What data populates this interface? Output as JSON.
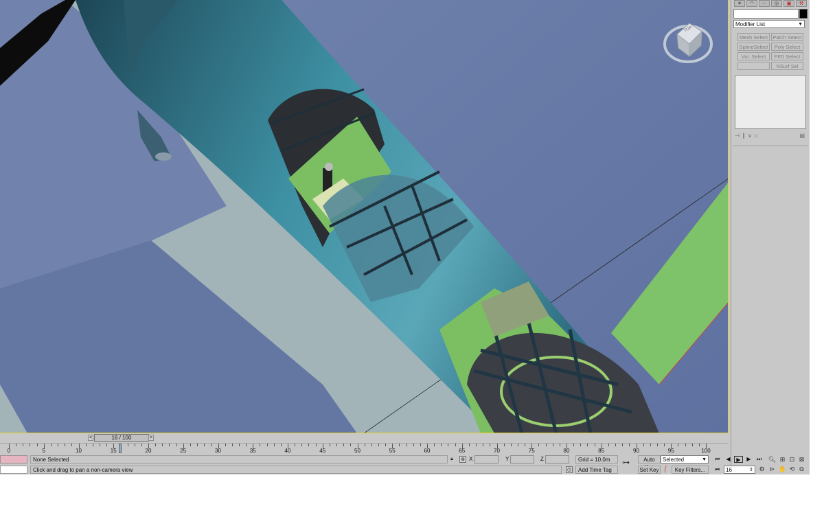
{
  "command_panel": {
    "tabs": [
      "create-icon",
      "modify-icon",
      "hierarchy-icon",
      "motion-icon",
      "display-icon",
      "utilities-icon"
    ],
    "modifier_list": "Modifier List",
    "buttons": [
      {
        "label": "Mesh Select",
        "key": "mesh"
      },
      {
        "label": "Patch Select",
        "key": "patch"
      },
      {
        "label": "SplineSelect",
        "key": "spline"
      },
      {
        "label": "Poly Select",
        "key": "poly"
      },
      {
        "label": "Vol. Select",
        "key": "vol"
      },
      {
        "label": "FFD Select",
        "key": "ffd"
      },
      {
        "label": "",
        "key": "blank"
      },
      {
        "label": "NSurf Sel",
        "key": "nsurf"
      }
    ]
  },
  "viewcube": {
    "label": "TOP"
  },
  "time_slider": {
    "label": "16 / 100",
    "prev": "<",
    "next": ">"
  },
  "trackbar": {
    "ticks": [
      "0",
      "5",
      "10",
      "15",
      "20",
      "25",
      "30",
      "35",
      "40",
      "45",
      "50",
      "55",
      "60",
      "65",
      "70",
      "75",
      "80",
      "85",
      "90",
      "95",
      "100"
    ],
    "current_frame": 16
  },
  "status": {
    "selection": "None Selected",
    "prompt": "Click and drag to pan a non-camera view",
    "x_label": "X",
    "y_label": "Y",
    "z_label": "Z",
    "grid": "Grid = 10.0m",
    "add_time_tag": "Add Time Tag",
    "auto_key": "Auto Key",
    "set_key": "Set Key",
    "selected": "Selected",
    "key_filters": "Key Filters...",
    "frame": "16"
  },
  "colors": {
    "sky": "#a3b4b9",
    "wing": "#6d7fa8",
    "fuselage": "#3f8ea0",
    "interior_green": "#7cbf63",
    "viewport_border": "#e6d21c"
  }
}
